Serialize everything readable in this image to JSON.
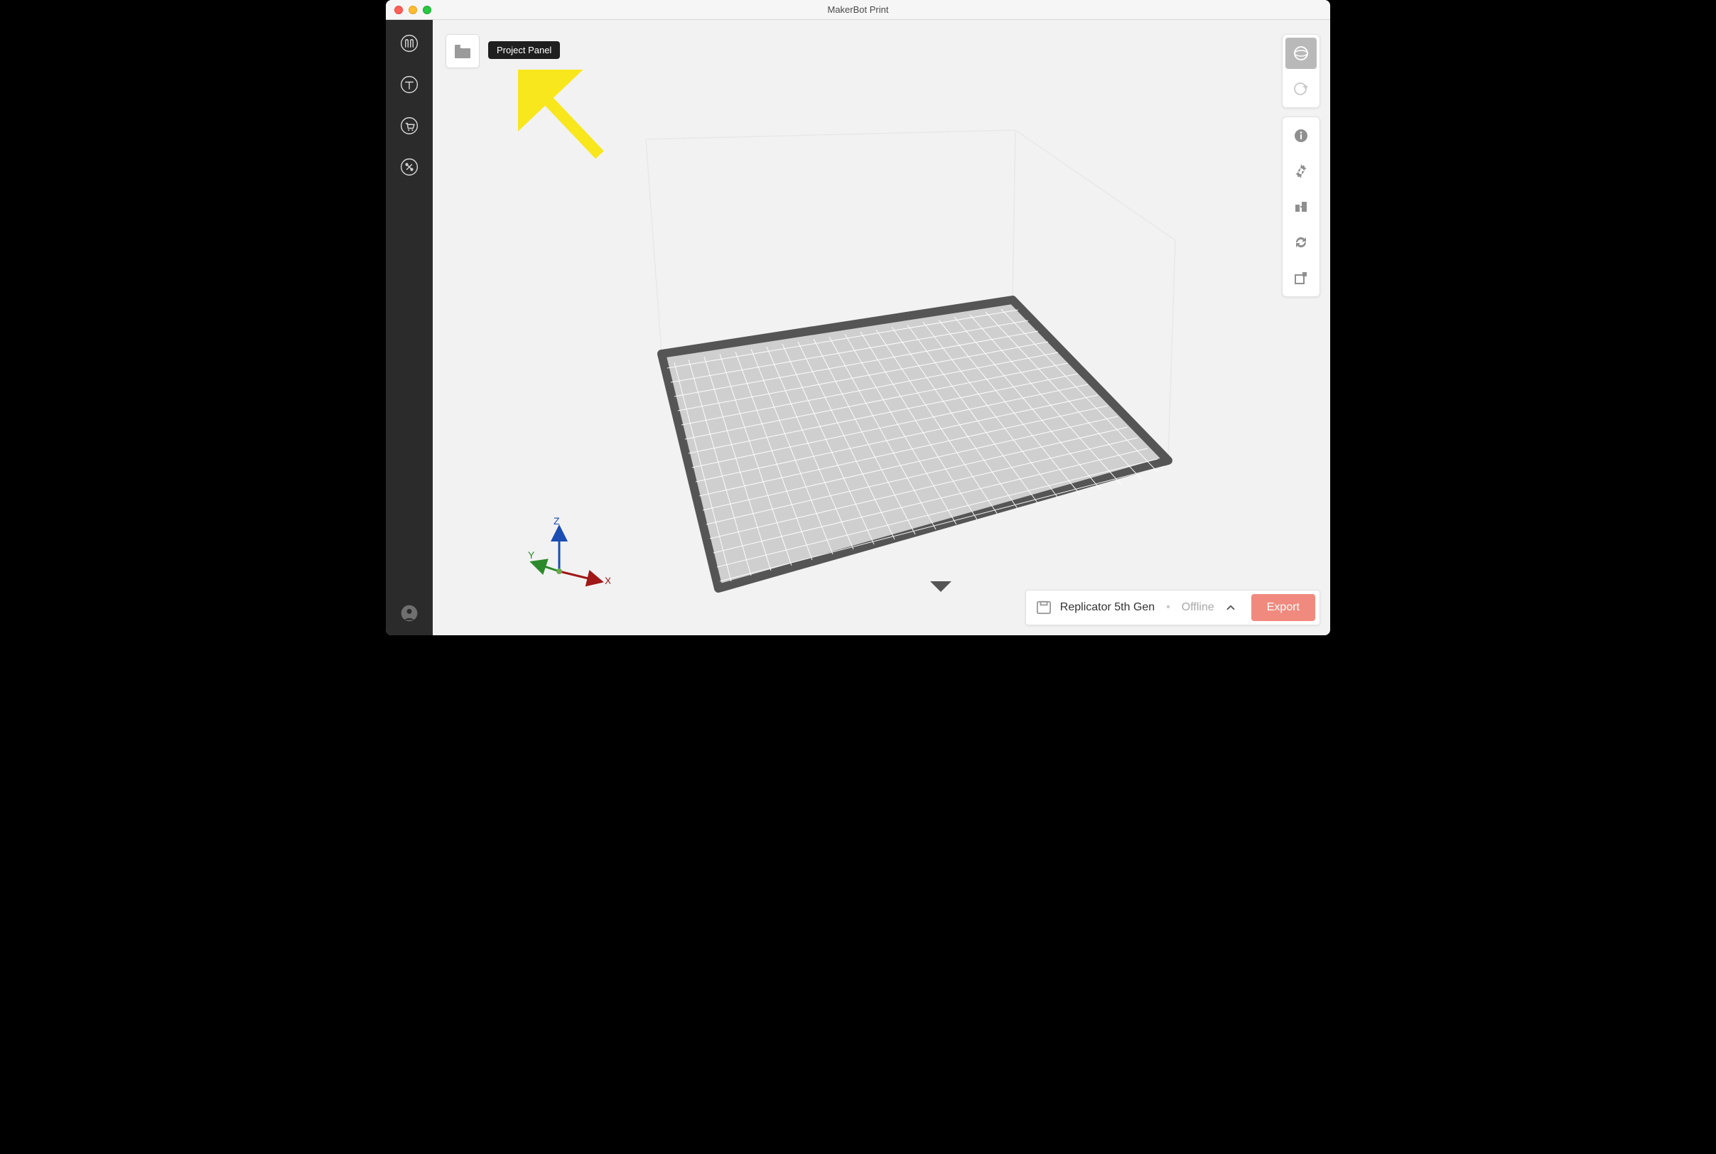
{
  "window": {
    "title": "MakerBot Print"
  },
  "tooltip": {
    "project_panel": "Project Panel"
  },
  "sidebar": {
    "icons": [
      "makerbot-logo-icon",
      "thingiverse-icon",
      "store-icon",
      "tools-icon"
    ],
    "bottom_icon": "account-icon"
  },
  "right_tools": {
    "group1": [
      "view-3d-icon",
      "view-slice-icon"
    ],
    "group2": [
      "info-icon",
      "settings-icon",
      "arrange-icon",
      "sync-icon",
      "place-on-face-icon"
    ]
  },
  "axis": {
    "x": "X",
    "y": "Y",
    "z": "Z"
  },
  "status": {
    "printer_name": "Replicator 5th Gen",
    "printer_status": "Offline",
    "export_label": "Export"
  }
}
